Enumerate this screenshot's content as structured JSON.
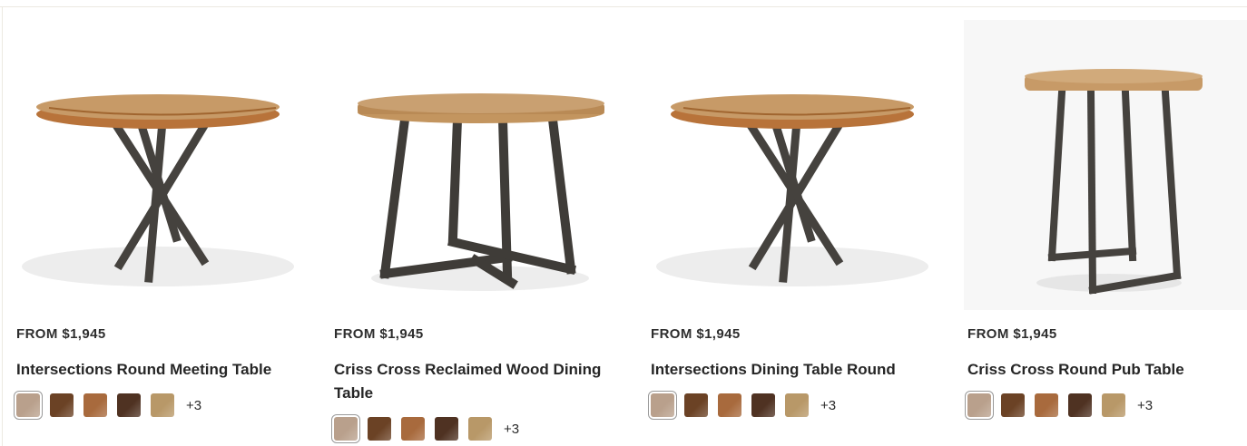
{
  "products": [
    {
      "price": "FROM $1,945",
      "title": "Intersections Round Meeting Table",
      "image_alt": "Intersections Round Meeting Table",
      "more": "+3",
      "swatches": [
        "#b9a08c",
        "#6b4225",
        "#a86a3d",
        "#4f3222",
        "#b89868"
      ]
    },
    {
      "price": "FROM $1,945",
      "title": "Criss Cross Reclaimed Wood Dining Table",
      "image_alt": "Criss Cross Reclaimed Wood Dining Table",
      "more": "+3",
      "swatches": [
        "#b9a08c",
        "#6b4225",
        "#a86a3d",
        "#4f3222",
        "#b89868"
      ]
    },
    {
      "price": "FROM $1,945",
      "title": "Intersections Dining Table Round",
      "image_alt": "Intersections Dining Table Round",
      "more": "+3",
      "swatches": [
        "#b9a08c",
        "#6b4225",
        "#a86a3d",
        "#4f3222",
        "#b89868"
      ]
    },
    {
      "price": "FROM $1,945",
      "title": "Criss Cross Round Pub Table",
      "image_alt": "Criss Cross Round Pub Table",
      "more": "+3",
      "swatches": [
        "#b9a08c",
        "#6b4225",
        "#a86a3d",
        "#4f3222",
        "#b89868"
      ]
    }
  ],
  "colors": {
    "wood_top": "#c08f5a",
    "wood_edge": "#b9773f",
    "metal": "#3f3c38",
    "shadow": "#e9e9e9"
  }
}
